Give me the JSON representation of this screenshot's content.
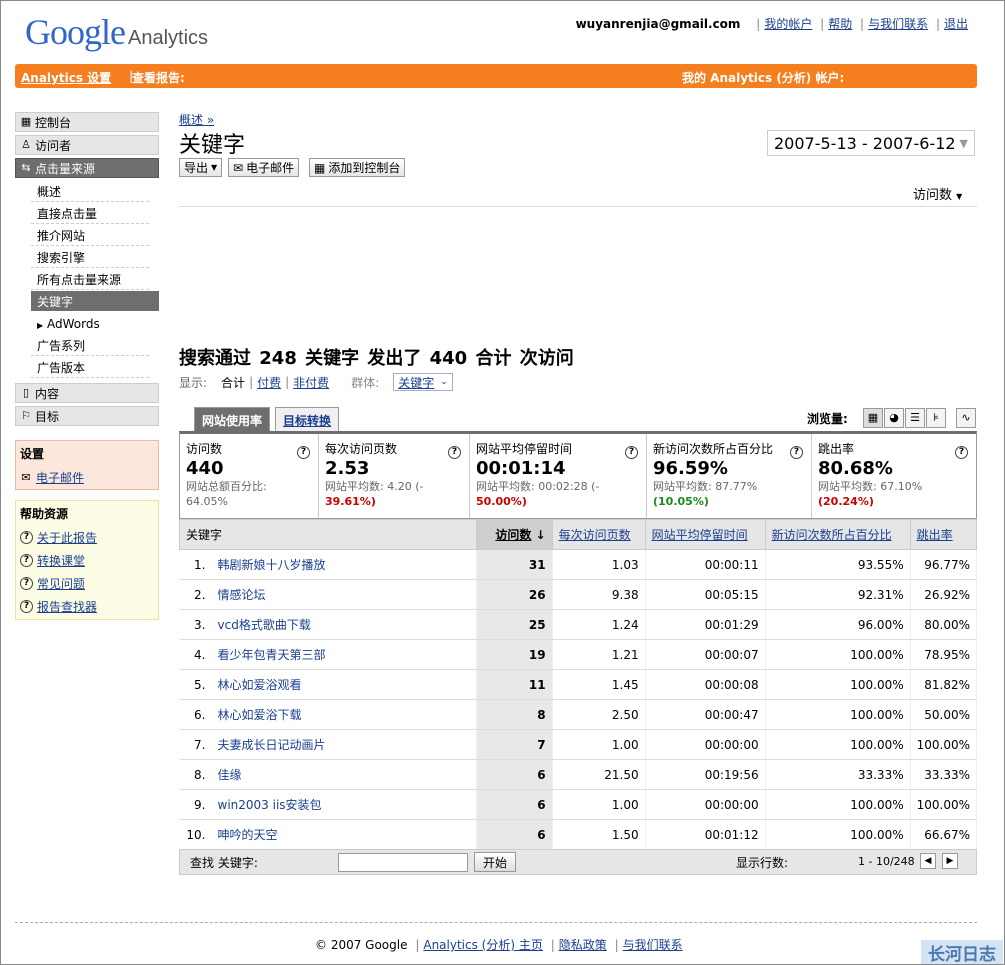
{
  "header": {
    "logo_google": "Google",
    "logo_analytics": "Analytics",
    "email": "wuyanrenjia@gmail.com",
    "links": [
      "我的帐户",
      "帮助",
      "与我们联系",
      "退出"
    ]
  },
  "orange_bar": {
    "settings": "Analytics 设置",
    "view_reports": "查看报告:",
    "my_accounts": "我的 Analytics (分析) 帐户:"
  },
  "sidebar": {
    "main": [
      "控制台",
      "访问者",
      "点击量来源",
      "内容",
      "目标"
    ],
    "traffic_sub": [
      "概述",
      "直接点击量",
      "推介网站",
      "搜索引擎",
      "所有点击量来源",
      "关键字"
    ],
    "adwords": "AdWords",
    "adwords_sub": [
      "广告系列",
      "广告版本"
    ],
    "settings_title": "设置",
    "settings_email": "电子邮件",
    "help_title": "帮助资源",
    "help_links": [
      "关于此报告",
      "转换课堂",
      "常见问题",
      "报告查找器"
    ]
  },
  "main": {
    "breadcrumb": "概述 »",
    "title": "关键字",
    "daterange": "2007-5-13 - 2007-6-12",
    "toolbar": [
      "导出",
      "电子邮件",
      "添加到控制台"
    ],
    "metric_selector": "访问数",
    "summary": "搜索通过  248 关键字  发出了  440 合计  次访问",
    "show_label": "显示:",
    "show_all": "合计",
    "show_paid": "付费",
    "show_nonpaid": "非付费",
    "segment_label": "群体:",
    "segment_value": "关键字",
    "tab_usage": "网站使用率",
    "tab_conv": "目标转换",
    "view_label": "浏览量:"
  },
  "scorecard": [
    {
      "title": "访问数",
      "value": "440",
      "sub1": "网站总额百分比:",
      "sub2": "64.05%",
      "sub2_class": ""
    },
    {
      "title": "每次访问页数",
      "value": "2.53",
      "sub1": "网站平均数:  4.20 (-",
      "sub2": "39.61%)",
      "sub2_class": "neg"
    },
    {
      "title": "网站平均停留时间",
      "value": "00:01:14",
      "sub1": "网站平均数:  00:02:28 (-",
      "sub2": "50.00%)",
      "sub2_class": "neg"
    },
    {
      "title": "新访问次数所占百分比",
      "value": "96.59%",
      "sub1": "网站平均数:  87.77%",
      "sub2": "(10.05%)",
      "sub2_class": "pos"
    },
    {
      "title": "跳出率",
      "value": "80.68%",
      "sub1": "网站平均数:  67.10%",
      "sub2": "(20.24%)",
      "sub2_class": "neg"
    }
  ],
  "table": {
    "headers": [
      "关键字",
      "访问数",
      "每次访问页数",
      "网站平均停留时间",
      "新访问次数所占百分比",
      "跳出率"
    ],
    "rows": [
      [
        "1.",
        "韩剧新娘十八岁播放",
        "31",
        "1.03",
        "00:00:11",
        "93.55%",
        "96.77%"
      ],
      [
        "2.",
        "情感论坛",
        "26",
        "9.38",
        "00:05:15",
        "92.31%",
        "26.92%"
      ],
      [
        "3.",
        "vcd格式歌曲下载",
        "25",
        "1.24",
        "00:01:29",
        "96.00%",
        "80.00%"
      ],
      [
        "4.",
        "看少年包青天第三部",
        "19",
        "1.21",
        "00:00:07",
        "100.00%",
        "78.95%"
      ],
      [
        "5.",
        "林心如爱浴观看",
        "11",
        "1.45",
        "00:00:08",
        "100.00%",
        "81.82%"
      ],
      [
        "6.",
        "林心如爱浴下载",
        "8",
        "2.50",
        "00:00:47",
        "100.00%",
        "50.00%"
      ],
      [
        "7.",
        "夫妻成长日记动画片",
        "7",
        "1.00",
        "00:00:00",
        "100.00%",
        "100.00%"
      ],
      [
        "8.",
        "佳缘",
        "6",
        "21.50",
        "00:19:56",
        "33.33%",
        "33.33%"
      ],
      [
        "9.",
        "win2003 iis安装包",
        "6",
        "1.00",
        "00:00:00",
        "100.00%",
        "100.00%"
      ],
      [
        "10.",
        "呻吟的天空",
        "6",
        "1.50",
        "00:01:12",
        "100.00%",
        "66.67%"
      ]
    ]
  },
  "findbar": {
    "label": "查找 关键字:",
    "input_value": "",
    "go": "开始",
    "rows_label": "显示行数:",
    "range": "1 - 10/248"
  },
  "footer": {
    "copyright": "© 2007 Google",
    "links": [
      "Analytics (分析) 主页",
      "隐私政策",
      "与我们联系"
    ]
  },
  "watermark": "长河日志"
}
